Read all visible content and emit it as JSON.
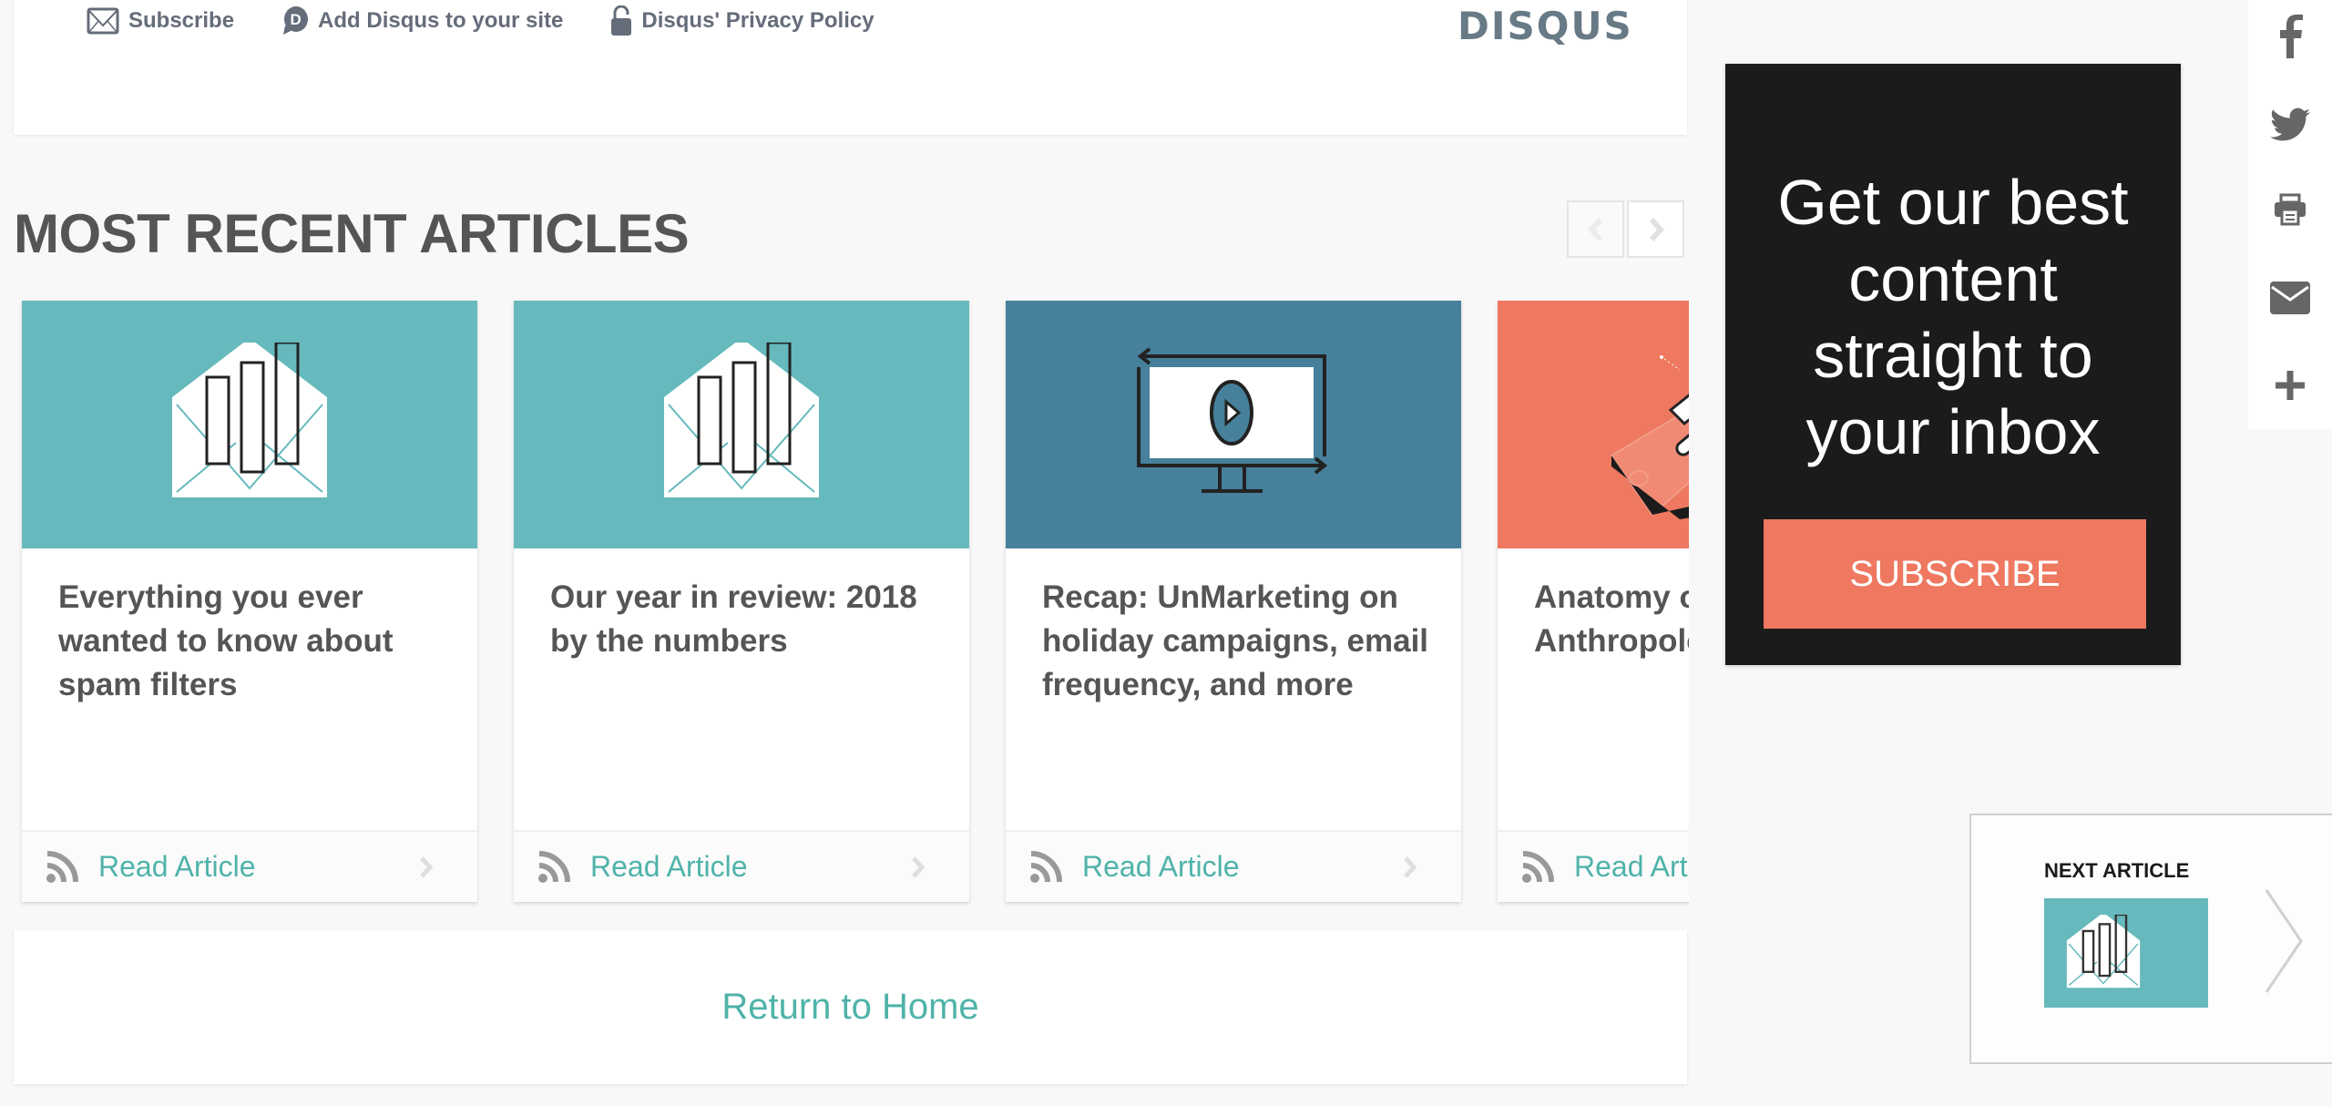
{
  "disqus_footer": {
    "links": [
      {
        "label": "Subscribe",
        "icon": "envelope-icon"
      },
      {
        "label": "Add Disqus to your site",
        "icon": "disqus-d-icon"
      },
      {
        "label": "Disqus' Privacy Policy",
        "icon": "lock-icon"
      }
    ],
    "logo": "DISQUS"
  },
  "recent": {
    "title": "MOST RECENT ARTICLES",
    "prev_icon": "chevron-left-icon",
    "next_icon": "chevron-right-icon",
    "cards": [
      {
        "title": "Everything you ever wanted to know about spam filters",
        "image": "envelope-chart-illustration",
        "bg": "#66b9bc",
        "cta": "Read Article"
      },
      {
        "title": "Our year in review: 2018 by the numbers",
        "image": "envelope-chart-illustration",
        "bg": "#66b9bc",
        "cta": "Read Article"
      },
      {
        "title": "Recap: UnMarketing on holiday campaigns, email frequency, and more",
        "image": "monitor-video-illustration",
        "bg": "#47809a",
        "cta": "Read Article"
      },
      {
        "title": "Anatomy of Anthropologie",
        "image": "phone-illustration",
        "bg": "#ee7860",
        "cta": "Read Article"
      }
    ]
  },
  "return_home": "Return to Home",
  "promo": {
    "text": "Get our best content straight to your inbox",
    "button": "SUBSCRIBE",
    "button_color": "#ee7860"
  },
  "share": [
    "facebook-icon",
    "twitter-icon",
    "print-icon",
    "email-icon",
    "plus-icon"
  ],
  "next_article": {
    "label": "NEXT ARTICLE",
    "image": "envelope-chart-illustration"
  },
  "colors": {
    "accent_teal": "#4fb3a9",
    "text_dark": "#555555",
    "disqus_gray": "#656c7a"
  }
}
